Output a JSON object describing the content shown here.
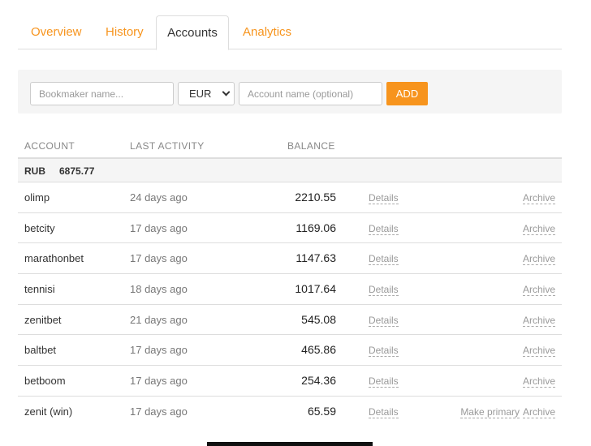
{
  "tabs": [
    {
      "label": "Overview"
    },
    {
      "label": "History"
    },
    {
      "label": "Accounts"
    },
    {
      "label": "Analytics"
    }
  ],
  "add_form": {
    "bookmaker_placeholder": "Bookmaker name...",
    "currency_selected": "EUR",
    "account_placeholder": "Account name (optional)",
    "add_label": "ADD"
  },
  "table": {
    "headers": {
      "account": "ACCOUNT",
      "last_activity": "LAST ACTIVITY",
      "balance": "BALANCE"
    },
    "group": {
      "currency": "RUB",
      "total": "6875.77"
    },
    "rows": [
      {
        "name": "olimp",
        "activity": "24 days ago",
        "balance": "2210.55",
        "details": "Details",
        "archive": "Archive"
      },
      {
        "name": "betcity",
        "activity": "17 days ago",
        "balance": "1169.06",
        "details": "Details",
        "archive": "Archive"
      },
      {
        "name": "marathonbet",
        "activity": "17 days ago",
        "balance": "1147.63",
        "details": "Details",
        "archive": "Archive"
      },
      {
        "name": "tennisi",
        "activity": "18 days ago",
        "balance": "1017.64",
        "details": "Details",
        "archive": "Archive"
      },
      {
        "name": "zenitbet",
        "activity": "21 days ago",
        "balance": "545.08",
        "details": "Details",
        "archive": "Archive"
      },
      {
        "name": "baltbet",
        "activity": "17 days ago",
        "balance": "465.86",
        "details": "Details",
        "archive": "Archive"
      },
      {
        "name": "betboom",
        "activity": "17 days ago",
        "balance": "254.36",
        "details": "Details",
        "archive": "Archive"
      },
      {
        "name": "zenit (win)",
        "activity": "17 days ago",
        "balance": "65.59",
        "details": "Details",
        "make_primary": "Make primary",
        "archive": "Archive"
      }
    ]
  },
  "colors": {
    "accent": "#f7941d",
    "panel": "#f5f5f5",
    "border": "#dddddd"
  }
}
